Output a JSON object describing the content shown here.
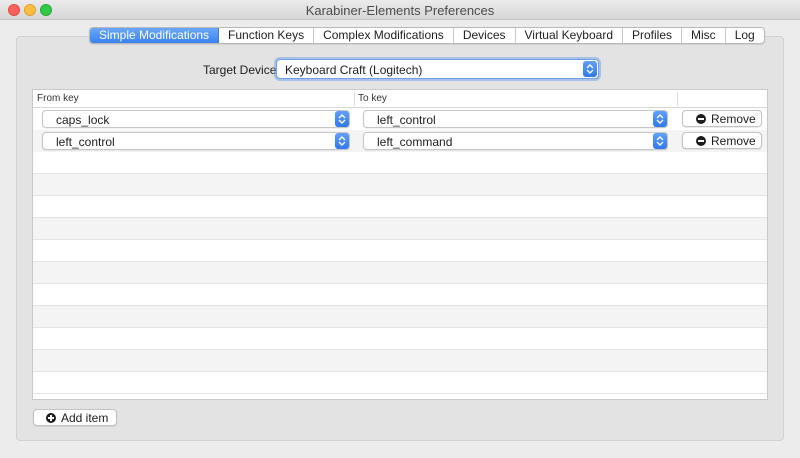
{
  "window": {
    "title": "Karabiner-Elements Preferences"
  },
  "tabs": [
    {
      "label": "Simple Modifications",
      "active": true
    },
    {
      "label": "Function Keys",
      "active": false
    },
    {
      "label": "Complex Modifications",
      "active": false
    },
    {
      "label": "Devices",
      "active": false
    },
    {
      "label": "Virtual Keyboard",
      "active": false
    },
    {
      "label": "Profiles",
      "active": false
    },
    {
      "label": "Misc",
      "active": false
    },
    {
      "label": "Log",
      "active": false
    }
  ],
  "target_device": {
    "label": "Target Device:",
    "value": "Keyboard Craft (Logitech)"
  },
  "table": {
    "headers": {
      "from": "From key",
      "to": "To key"
    },
    "rows": [
      {
        "from": "caps_lock",
        "to": "left_control",
        "remove_label": "Remove"
      },
      {
        "from": "left_control",
        "to": "left_command",
        "remove_label": "Remove"
      }
    ]
  },
  "add_item": {
    "label": "Add item"
  },
  "colors": {
    "accent": "#3b82f0",
    "close": "#fc605c",
    "minimize": "#fdbc40",
    "zoom": "#34c84a"
  },
  "icons": {
    "remove": "minus-circle-icon",
    "add": "plus-circle-icon",
    "stepper": "up-down-chevron-icon"
  }
}
